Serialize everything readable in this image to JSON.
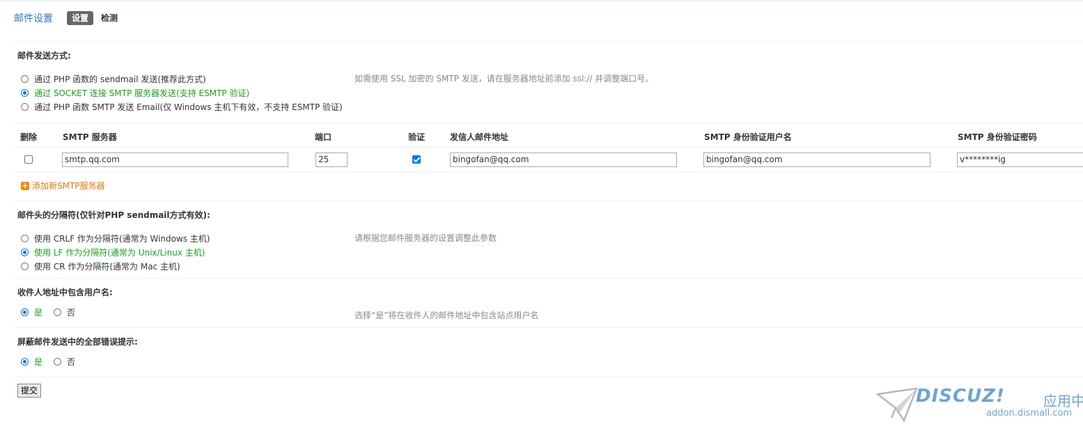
{
  "header": {
    "title": "邮件设置",
    "tabs": [
      "设置",
      "检测"
    ]
  },
  "send_method": {
    "title": "邮件发送方式:",
    "options": [
      "通过 PHP 函数的 sendmail 发送(推荐此方式)",
      "通过 SOCKET 连接 SMTP 服务器发送(支持 ESMTP 验证)",
      "通过 PHP 函数 SMTP 发送 Email(仅 Windows 主机下有效，不支持 ESMTP 验证)"
    ],
    "selected_index": 1,
    "hint": "如需使用 SSL 加密的 SMTP 发送，请在服务器地址前添加 ssl:// 并调整端口号。"
  },
  "smtp_table": {
    "headers": [
      "删除",
      "SMTP 服务器",
      "端口",
      "验证",
      "发信人邮件地址",
      "SMTP 身份验证用户名",
      "SMTP 身份验证密码"
    ],
    "rows": [
      {
        "delete_checked": false,
        "server": "smtp.qq.com",
        "port": "25",
        "auth_checked": true,
        "from": "bingofan@qq.com",
        "username": "bingofan@qq.com",
        "password": "v********ig"
      }
    ],
    "add_label": "添加新SMTP服务器"
  },
  "separator": {
    "title": "邮件头的分隔符(仅针对PHP sendmail方式有效):",
    "options": [
      "使用 CRLF 作为分隔符(通常为 Windows 主机)",
      "使用 LF 作为分隔符(通常为 Unix/Linux 主机)",
      "使用 CR 作为分隔符(通常为 Mac 主机)"
    ],
    "selected_index": 1,
    "hint": "请根据您邮件服务器的设置调整此参数"
  },
  "include_username": {
    "title": "收件人地址中包含用户名:",
    "yes": "是",
    "no": "否",
    "selected": "yes",
    "hint": "选择“是”将在收件人的邮件地址中包含站点用户名"
  },
  "suppress_errors": {
    "title": "屏蔽邮件发送中的全部错误提示:",
    "yes": "是",
    "no": "否",
    "selected": "yes"
  },
  "submit_label": "提交",
  "watermark": {
    "brand": "DISCUZ!",
    "subtitle": "应用中心",
    "url": "addon.dismall.com"
  },
  "colors": {
    "title_blue": "#2b7ac1",
    "selected_green": "#1aa01a",
    "add_orange": "#e07b00",
    "accent": "#0075ff"
  }
}
